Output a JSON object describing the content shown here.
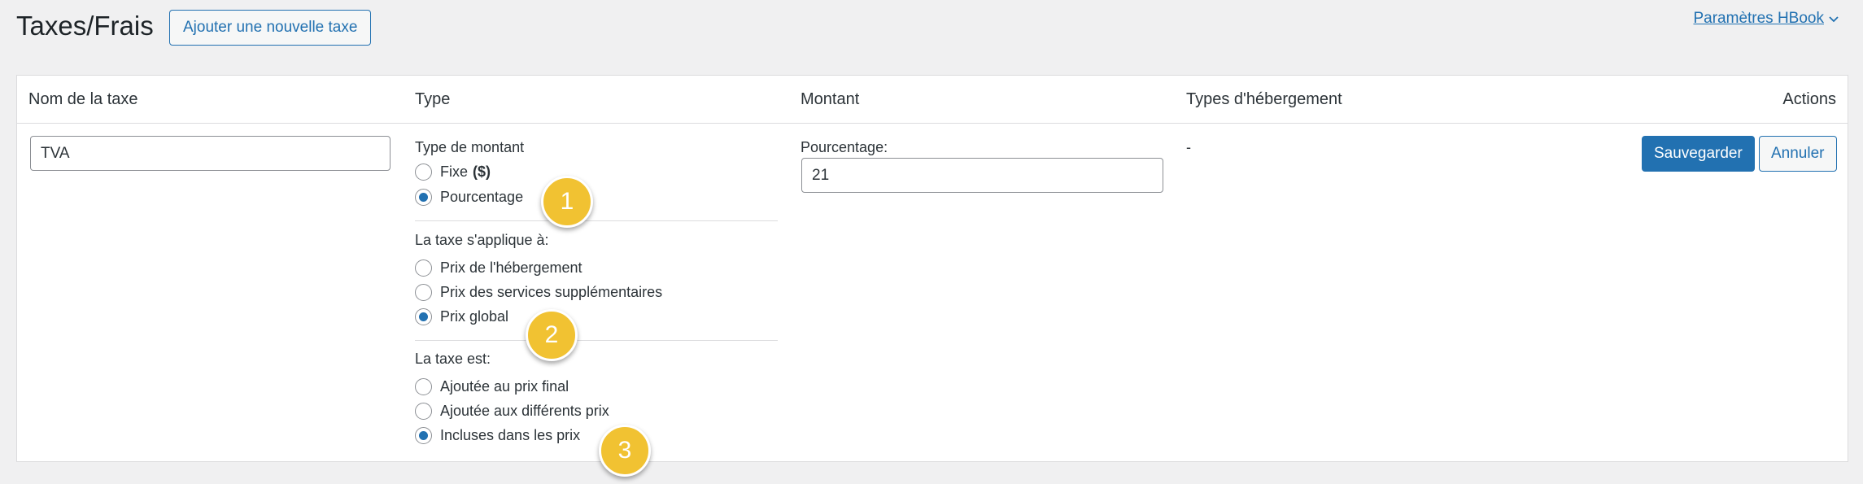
{
  "header": {
    "title": "Taxes/Frais",
    "add_button": "Ajouter une nouvelle taxe",
    "settings_link": "Paramètres HBook"
  },
  "table": {
    "columns": {
      "name": "Nom de la taxe",
      "type": "Type",
      "amount": "Montant",
      "accommodation_types": "Types d'hébergement",
      "actions": "Actions"
    },
    "row": {
      "name_value": "TVA",
      "amount_type": {
        "label": "Type de montant",
        "options": [
          "Fixe",
          "Pourcentage"
        ],
        "fixed_suffix": "($)",
        "selected": "Pourcentage"
      },
      "applies_to": {
        "label": "La taxe s'applique à:",
        "options": [
          "Prix de l'hébergement",
          "Prix des services supplémentaires",
          "Prix global"
        ],
        "selected": "Prix global"
      },
      "tax_is": {
        "label": "La taxe est:",
        "options": [
          "Ajoutée au prix final",
          "Ajoutée aux différents prix",
          "Incluses dans les prix"
        ],
        "selected": "Incluses dans les prix"
      },
      "amount": {
        "label": "Pourcentage:",
        "value": "21"
      },
      "accommodation_types_value": "-",
      "save_button": "Sauvegarder",
      "cancel_button": "Annuler"
    }
  },
  "annotations": [
    "1",
    "2",
    "3"
  ],
  "colors": {
    "accent": "#2271b1",
    "badge": "#f1c232",
    "background": "#f0f0f1"
  }
}
